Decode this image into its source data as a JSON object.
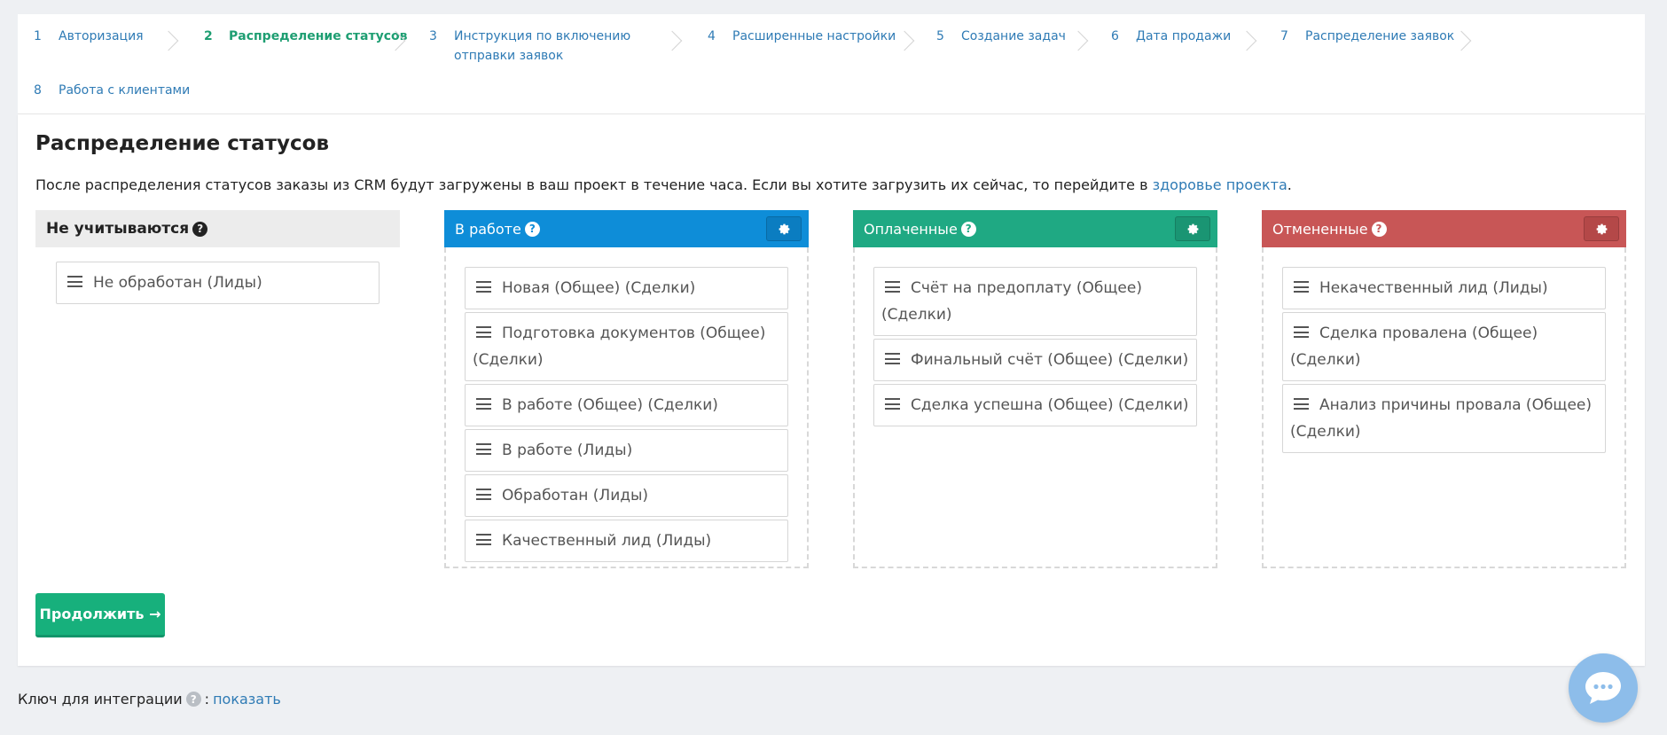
{
  "steps": [
    {
      "num": "1",
      "label": "Авторизация"
    },
    {
      "num": "2",
      "label": "Распределение статусов"
    },
    {
      "num": "3",
      "label": "Инструкция по включению отправки заявок"
    },
    {
      "num": "4",
      "label": "Расширенные настройки"
    },
    {
      "num": "5",
      "label": "Создание задач"
    },
    {
      "num": "6",
      "label": "Дата продажи"
    },
    {
      "num": "7",
      "label": "Распределение заявок"
    },
    {
      "num": "8",
      "label": "Работа с клиентами"
    }
  ],
  "page": {
    "title": "Распределение статусов",
    "desc_text": "После распределения статусов заказы из CRM будут загружены в ваш проект в течение часа. Если вы хотите загрузить их сейчас, то перейдите в ",
    "desc_link": "здоровье проекта",
    "desc_end": "."
  },
  "columns": {
    "ignored": {
      "title": "Не учитываются",
      "items": [
        "Не обработан (Лиды)"
      ]
    },
    "in_work": {
      "title": "В работе",
      "items": [
        "Новая (Общее) (Сделки)",
        "Подготовка документов (Общее) (Сделки)",
        "В работе (Общее) (Сделки)",
        "В работе (Лиды)",
        "Обработан (Лиды)",
        "Качественный лид (Лиды)"
      ]
    },
    "paid": {
      "title": "Оплаченные",
      "items": [
        "Счёт на предоплату (Общее) (Сделки)",
        "Финальный счёт (Общее) (Сделки)",
        "Сделка успешна (Общее) (Сделки)"
      ]
    },
    "cancelled": {
      "title": "Отмененные",
      "items": [
        "Некачественный лид (Лиды)",
        "Сделка провалена (Общее) (Сделки)",
        "Анализ причины провала (Общее) (Сделки)"
      ]
    }
  },
  "continue_label": "Продолжить →",
  "footer": {
    "label": "Ключ для интеграции",
    "separator": " : ",
    "link": "показать"
  },
  "icons": {
    "help": "question-circle-icon",
    "gear": "gear-icon",
    "drag": "drag-handle-icon",
    "chevron": "chevron-right-icon",
    "chat": "chat-bubble-icon"
  },
  "colors": {
    "active_step": "#1e9e72",
    "link": "#2f7bb5",
    "in_work": "#0e8dd8",
    "paid": "#1fa983",
    "cancelled": "#c85656",
    "continue": "#17b07c"
  }
}
